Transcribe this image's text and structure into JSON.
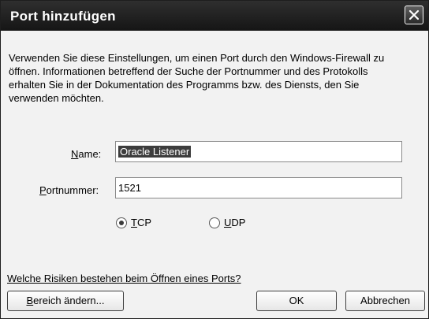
{
  "window": {
    "title": "Port hinzufügen"
  },
  "description": "Verwenden Sie diese Einstellungen, um einen Port durch den Windows-Firewall zu öffnen. Informationen betreffend der Suche der Portnummer und des Protokolls erhalten Sie in der Dokumentation des Programms bzw. des Diensts, den Sie verwenden möchten.",
  "form": {
    "name_label_accel": "N",
    "name_label_rest": "ame:",
    "name_value": "Oracle Listener",
    "port_label_accel": "P",
    "port_label_rest": "ortnummer:",
    "port_value": "1521",
    "tcp_accel": "T",
    "tcp_rest": "CP",
    "udp_accel": "U",
    "udp_rest": "DP",
    "protocol_selected": "TCP"
  },
  "link": {
    "text": "Welche Risiken bestehen beim Öffnen eines Ports?"
  },
  "buttons": {
    "scope_accel": "B",
    "scope_rest": "ereich ändern...",
    "ok": "OK",
    "cancel": "Abbrechen"
  }
}
